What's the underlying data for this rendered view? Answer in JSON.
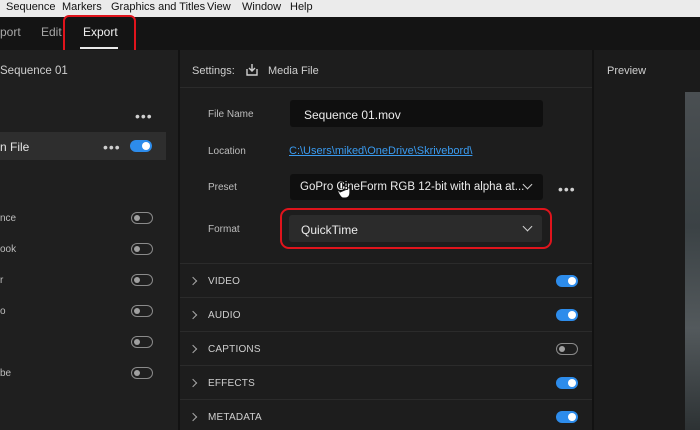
{
  "menu": [
    "Sequence",
    "Markers",
    "Graphics and Titles",
    "View",
    "Window",
    "Help"
  ],
  "tabs": {
    "import": "port",
    "edit": "Edit",
    "export": "Export"
  },
  "left": {
    "sequence_title": "Sequence 01",
    "media_file_label": "n File",
    "destinations": [
      {
        "label": "nce",
        "on": false
      },
      {
        "label": "ook",
        "on": false
      },
      {
        "label": "r",
        "on": false
      },
      {
        "label": "o",
        "on": false
      },
      {
        "label": "",
        "on": false
      },
      {
        "label": "be",
        "on": false
      }
    ]
  },
  "settings": {
    "header_label": "Settings:",
    "header_value": "Media File",
    "file_name_label": "File Name",
    "file_name_value": "Sequence 01.mov",
    "location_label": "Location",
    "location_value": "C:\\Users\\miked\\OneDrive\\Skrivebord\\",
    "preset_label": "Preset",
    "preset_value": "GoPro CineForm RGB 12-bit with alpha at...",
    "format_label": "Format",
    "format_value": "QuickTime"
  },
  "sections": [
    {
      "label": "VIDEO",
      "on": true
    },
    {
      "label": "AUDIO",
      "on": true
    },
    {
      "label": "CAPTIONS",
      "on": false
    },
    {
      "label": "EFFECTS",
      "on": true
    },
    {
      "label": "METADATA",
      "on": true
    }
  ],
  "preview": {
    "title": "Preview"
  },
  "colors": {
    "accent": "#2d8ceb",
    "highlight": "#e0141c",
    "link": "#3a9bf0"
  }
}
